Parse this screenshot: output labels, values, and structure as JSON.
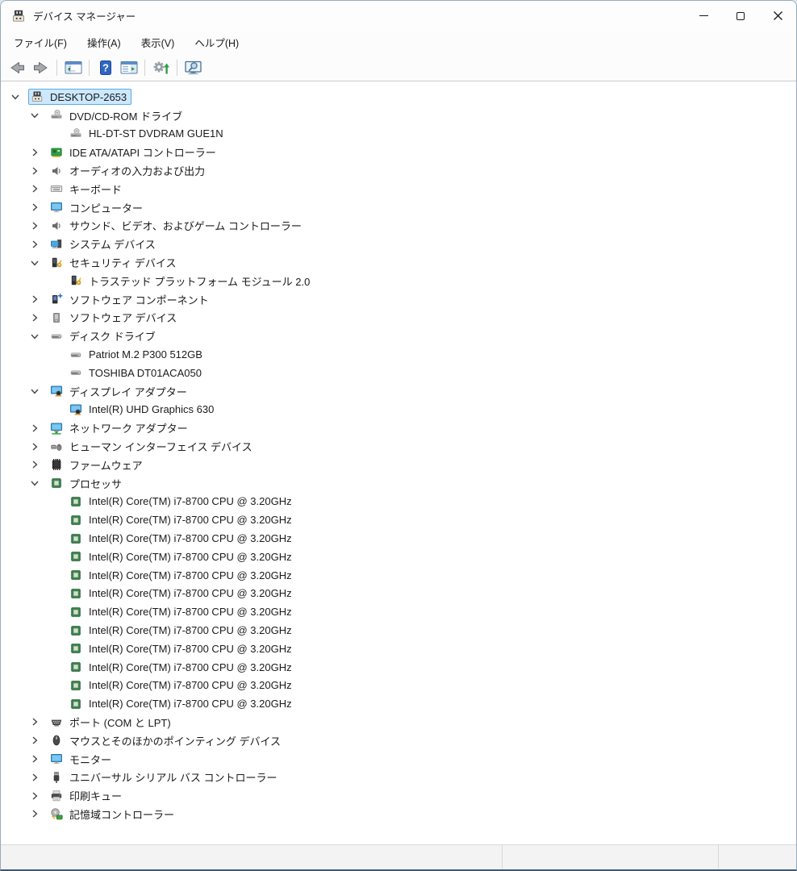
{
  "window": {
    "title": "デバイス マネージャー",
    "app_icon": "device-manager-icon",
    "controls": [
      {
        "name": "minimize-button",
        "icon": "minimize-icon"
      },
      {
        "name": "maximize-button",
        "icon": "maximize-icon"
      },
      {
        "name": "close-button",
        "icon": "close-icon"
      }
    ]
  },
  "menu": {
    "items": [
      {
        "name": "menu-file",
        "label": "ファイル(F)"
      },
      {
        "name": "menu-action",
        "label": "操作(A)"
      },
      {
        "name": "menu-view",
        "label": "表示(V)"
      },
      {
        "name": "menu-help",
        "label": "ヘルプ(H)"
      }
    ]
  },
  "toolbar": {
    "buttons": [
      {
        "name": "back-button",
        "icon": "arrow-left-icon"
      },
      {
        "name": "forward-button",
        "icon": "arrow-right-icon"
      },
      {
        "name": "show-console-tree-button",
        "icon": "console-tree-window-icon"
      },
      {
        "name": "help-button",
        "icon": "help-icon"
      },
      {
        "name": "show-action-pane-button",
        "icon": "action-pane-window-icon"
      },
      {
        "name": "scan-hardware-changes-button",
        "icon": "scan-hardware-icon"
      },
      {
        "name": "device-search-button",
        "icon": "monitor-magnifier-icon"
      }
    ]
  },
  "tree": {
    "items": [
      {
        "level": 0,
        "state": "expanded",
        "icon": "computer-node-icon",
        "label": "DESKTOP-2653",
        "selected": true
      },
      {
        "level": 1,
        "state": "expanded",
        "icon": "cd-drive-icon",
        "label": "DVD/CD-ROM ドライブ"
      },
      {
        "level": 2,
        "state": "leaf",
        "icon": "cd-drive-icon",
        "label": "HL-DT-ST DVDRAM GUE1N"
      },
      {
        "level": 1,
        "state": "collapsed",
        "icon": "ide-controller-icon",
        "label": "IDE ATA/ATAPI コントローラー"
      },
      {
        "level": 1,
        "state": "collapsed",
        "icon": "speaker-icon",
        "label": "オーディオの入力および出力"
      },
      {
        "level": 1,
        "state": "collapsed",
        "icon": "keyboard-icon",
        "label": "キーボード"
      },
      {
        "level": 1,
        "state": "collapsed",
        "icon": "monitor-blue-icon",
        "label": "コンピューター"
      },
      {
        "level": 1,
        "state": "collapsed",
        "icon": "speaker-icon",
        "label": "サウンド、ビデオ、およびゲーム コントローラー"
      },
      {
        "level": 1,
        "state": "collapsed",
        "icon": "system-device-icon",
        "label": "システム デバイス"
      },
      {
        "level": 1,
        "state": "expanded",
        "icon": "security-device-icon",
        "label": "セキュリティ デバイス"
      },
      {
        "level": 2,
        "state": "leaf",
        "icon": "security-device-icon",
        "label": "トラステッド プラットフォーム モジュール 2.0"
      },
      {
        "level": 1,
        "state": "collapsed",
        "icon": "software-component-icon",
        "label": "ソフトウェア コンポーネント"
      },
      {
        "level": 1,
        "state": "collapsed",
        "icon": "software-device-icon",
        "label": "ソフトウェア デバイス"
      },
      {
        "level": 1,
        "state": "expanded",
        "icon": "disk-drive-icon",
        "label": "ディスク ドライブ"
      },
      {
        "level": 2,
        "state": "leaf",
        "icon": "disk-drive-icon",
        "label": "Patriot M.2 P300 512GB"
      },
      {
        "level": 2,
        "state": "leaf",
        "icon": "disk-drive-icon",
        "label": "TOSHIBA DT01ACA050"
      },
      {
        "level": 1,
        "state": "expanded",
        "icon": "display-adapter-icon",
        "label": "ディスプレイ アダプター"
      },
      {
        "level": 2,
        "state": "leaf",
        "icon": "display-adapter-icon",
        "label": "Intel(R) UHD Graphics 630"
      },
      {
        "level": 1,
        "state": "collapsed",
        "icon": "network-adapter-icon",
        "label": "ネットワーク アダプター"
      },
      {
        "level": 1,
        "state": "collapsed",
        "icon": "hid-icon",
        "label": "ヒューマン インターフェイス デバイス"
      },
      {
        "level": 1,
        "state": "collapsed",
        "icon": "firmware-chip-icon",
        "label": "ファームウェア"
      },
      {
        "level": 1,
        "state": "expanded",
        "icon": "processor-icon",
        "label": "プロセッサ"
      },
      {
        "level": 2,
        "state": "leaf",
        "icon": "processor-icon",
        "label": "Intel(R) Core(TM) i7-8700 CPU @ 3.20GHz"
      },
      {
        "level": 2,
        "state": "leaf",
        "icon": "processor-icon",
        "label": "Intel(R) Core(TM) i7-8700 CPU @ 3.20GHz"
      },
      {
        "level": 2,
        "state": "leaf",
        "icon": "processor-icon",
        "label": "Intel(R) Core(TM) i7-8700 CPU @ 3.20GHz"
      },
      {
        "level": 2,
        "state": "leaf",
        "icon": "processor-icon",
        "label": "Intel(R) Core(TM) i7-8700 CPU @ 3.20GHz"
      },
      {
        "level": 2,
        "state": "leaf",
        "icon": "processor-icon",
        "label": "Intel(R) Core(TM) i7-8700 CPU @ 3.20GHz"
      },
      {
        "level": 2,
        "state": "leaf",
        "icon": "processor-icon",
        "label": "Intel(R) Core(TM) i7-8700 CPU @ 3.20GHz"
      },
      {
        "level": 2,
        "state": "leaf",
        "icon": "processor-icon",
        "label": "Intel(R) Core(TM) i7-8700 CPU @ 3.20GHz"
      },
      {
        "level": 2,
        "state": "leaf",
        "icon": "processor-icon",
        "label": "Intel(R) Core(TM) i7-8700 CPU @ 3.20GHz"
      },
      {
        "level": 2,
        "state": "leaf",
        "icon": "processor-icon",
        "label": "Intel(R) Core(TM) i7-8700 CPU @ 3.20GHz"
      },
      {
        "level": 2,
        "state": "leaf",
        "icon": "processor-icon",
        "label": "Intel(R) Core(TM) i7-8700 CPU @ 3.20GHz"
      },
      {
        "level": 2,
        "state": "leaf",
        "icon": "processor-icon",
        "label": "Intel(R) Core(TM) i7-8700 CPU @ 3.20GHz"
      },
      {
        "level": 2,
        "state": "leaf",
        "icon": "processor-icon",
        "label": "Intel(R) Core(TM) i7-8700 CPU @ 3.20GHz"
      },
      {
        "level": 1,
        "state": "collapsed",
        "icon": "serial-port-icon",
        "label": "ポート (COM と LPT)"
      },
      {
        "level": 1,
        "state": "collapsed",
        "icon": "mouse-icon",
        "label": "マウスとそのほかのポインティング デバイス"
      },
      {
        "level": 1,
        "state": "collapsed",
        "icon": "monitor-blue-icon",
        "label": "モニター"
      },
      {
        "level": 1,
        "state": "collapsed",
        "icon": "usb-plug-icon",
        "label": "ユニバーサル シリアル バス コントローラー"
      },
      {
        "level": 1,
        "state": "collapsed",
        "icon": "printer-icon",
        "label": "印刷キュー"
      },
      {
        "level": 1,
        "state": "collapsed",
        "icon": "storage-controller-icon",
        "label": "記憶域コントローラー"
      }
    ]
  },
  "colors": {
    "selection_bg": "#cce8ff",
    "selection_border": "#58ade4",
    "titlebar_bg": "#fdfdfd",
    "statusbar_bg": "#f3f3f3",
    "window_border": "#93aabe",
    "text": "#1a1a1a"
  }
}
